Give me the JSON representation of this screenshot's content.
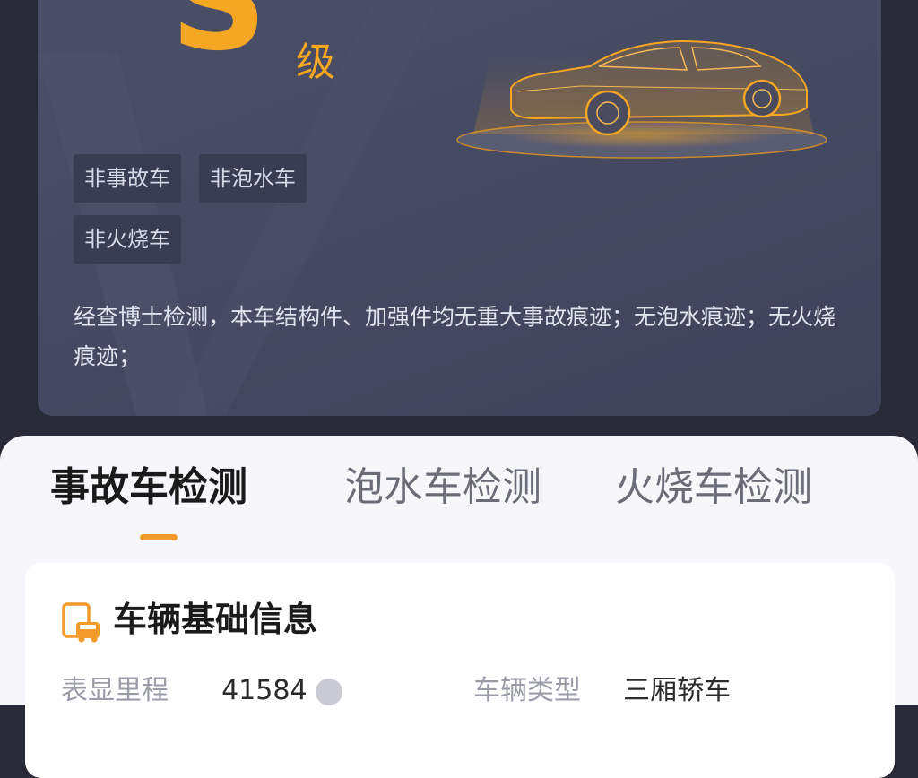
{
  "grade": {
    "letter": "S",
    "suffix": "级"
  },
  "tags": [
    "非事故车",
    "非泡水车",
    "非火烧车"
  ],
  "summary": "经查博士检测，本车结构件、加强件均无重大事故痕迹；无泡水痕迹；无火烧痕迹；",
  "tabs": [
    {
      "label": "事故车检测",
      "active": true
    },
    {
      "label": "泡水车检测",
      "active": false
    },
    {
      "label": "火烧车检测",
      "active": false
    }
  ],
  "basic_info": {
    "title": "车辆基础信息",
    "fields": [
      {
        "label": "表显里程",
        "value": "41584"
      },
      {
        "label": "车辆类型",
        "value": "三厢轿车"
      }
    ]
  },
  "colors": {
    "accent": "#f5a623",
    "indicator": "#f29a2a"
  }
}
